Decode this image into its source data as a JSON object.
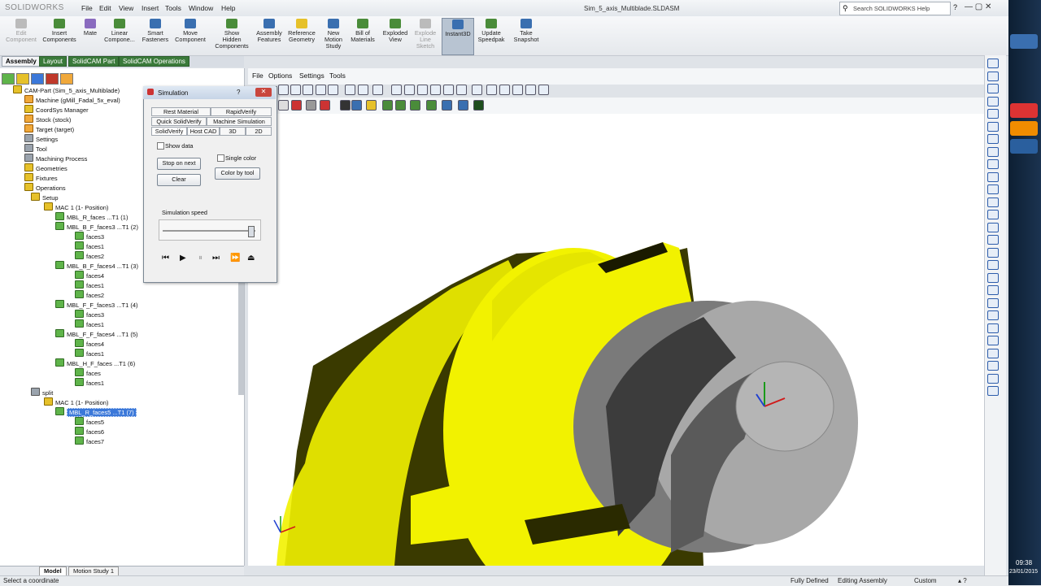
{
  "app": {
    "logo": "SOLIDWORKS",
    "title": "Sim_5_axis_Multiblade.SLDASM",
    "search_placeholder": "Search SOLIDWORKS Help"
  },
  "menu": [
    "File",
    "Edit",
    "View",
    "Insert",
    "Tools",
    "Window",
    "Help"
  ],
  "ribbon": [
    {
      "label": "Edit\nComponent",
      "dim": true
    },
    {
      "label": "Insert\nComponents"
    },
    {
      "label": "Mate"
    },
    {
      "label": "Linear\nCompone..."
    },
    {
      "label": "Smart\nFasteners"
    },
    {
      "label": "Move\nComponent"
    },
    {
      "label": "Show\nHidden\nComponents"
    },
    {
      "label": "Assembly\nFeatures"
    },
    {
      "label": "Reference\nGeometry"
    },
    {
      "label": "New\nMotion\nStudy"
    },
    {
      "label": "Bill of\nMaterials"
    },
    {
      "label": "Exploded\nView"
    },
    {
      "label": "Explode\nLine\nSketch",
      "dim": true
    },
    {
      "label": "Instant3D",
      "active": true
    },
    {
      "label": "Update\nSpeedpak"
    },
    {
      "label": "Take\nSnapshot"
    }
  ],
  "cm_tabs": [
    "Assembly",
    "Layout",
    "SolidCAM Part",
    "SolidCAM Operations"
  ],
  "tree": [
    {
      "label": "CAM-Part (Sim_5_axis_Multiblade)",
      "depth": 0,
      "icon": "y"
    },
    {
      "label": "Machine (gMill_Fadal_5x_eval)",
      "depth": 1,
      "icon": "or"
    },
    {
      "label": "CoordSys Manager",
      "depth": 1,
      "icon": "y"
    },
    {
      "label": "Stock (stock)",
      "depth": 1,
      "icon": "or"
    },
    {
      "label": "Target (target)",
      "depth": 1,
      "icon": "or"
    },
    {
      "label": "Settings",
      "depth": 1,
      "icon": "gr"
    },
    {
      "label": "Tool",
      "depth": 1,
      "icon": "gr"
    },
    {
      "label": "Machining Process",
      "depth": 1,
      "icon": "gr"
    },
    {
      "label": "Geometries",
      "depth": 1,
      "icon": "y"
    },
    {
      "label": "Fixtures",
      "depth": 1,
      "icon": "y"
    },
    {
      "label": "Operations",
      "depth": 1,
      "icon": "y"
    },
    {
      "label": "Setup",
      "depth": 2,
      "icon": "y"
    },
    {
      "label": "MAC 1 (1- Position)",
      "depth": 3,
      "icon": "y"
    },
    {
      "label": "MBL_R_faces ...T1 (1)",
      "depth": 4,
      "icon": "g"
    },
    {
      "label": "MBL_B_F_faces3 ...T1 (2)",
      "depth": 4,
      "icon": "g"
    },
    {
      "label": "faces3",
      "depth": 5,
      "icon": "g"
    },
    {
      "label": "faces1",
      "depth": 5,
      "icon": "g"
    },
    {
      "label": "faces2",
      "depth": 5,
      "icon": "g"
    },
    {
      "label": "MBL_B_F_faces4 ...T1 (3)",
      "depth": 4,
      "icon": "g"
    },
    {
      "label": "faces4",
      "depth": 5,
      "icon": "g"
    },
    {
      "label": "faces1",
      "depth": 5,
      "icon": "g"
    },
    {
      "label": "faces2",
      "depth": 5,
      "icon": "g"
    },
    {
      "label": "MBL_F_F_faces3 ...T1 (4)",
      "depth": 4,
      "icon": "g"
    },
    {
      "label": "faces3",
      "depth": 5,
      "icon": "g"
    },
    {
      "label": "faces1",
      "depth": 5,
      "icon": "g"
    },
    {
      "label": "MBL_F_F_faces4 ...T1 (5)",
      "depth": 4,
      "icon": "g"
    },
    {
      "label": "faces4",
      "depth": 5,
      "icon": "g"
    },
    {
      "label": "faces1",
      "depth": 5,
      "icon": "g"
    },
    {
      "label": "MBL_H_F_faces ...T1 (6)",
      "depth": 4,
      "icon": "g"
    },
    {
      "label": "faces",
      "depth": 5,
      "icon": "g"
    },
    {
      "label": "faces1",
      "depth": 5,
      "icon": "g"
    },
    {
      "label": "split",
      "depth": 2,
      "icon": "gr"
    },
    {
      "label": "MAC 1 (1- Position)",
      "depth": 3,
      "icon": "y"
    },
    {
      "label": "MBL_R_faces5 ...T1 (7)",
      "depth": 4,
      "icon": "g",
      "selected": true
    },
    {
      "label": "faces5",
      "depth": 5,
      "icon": "g"
    },
    {
      "label": "faces6",
      "depth": 5,
      "icon": "g"
    },
    {
      "label": "faces7",
      "depth": 5,
      "icon": "g"
    }
  ],
  "bottom_tabs": [
    "Model",
    "Motion Study 1"
  ],
  "status": {
    "left": "Select a coordinate",
    "defined": "Fully Defined",
    "mode": "Editing Assembly",
    "units": "Custom"
  },
  "gfx_menu": [
    "File",
    "Options",
    "Settings",
    "Tools"
  ],
  "simulation": {
    "title": "Simulation",
    "tabs_row1": [
      "Rest Material",
      "RapidVerify"
    ],
    "tabs_row2": [
      "Quick SolidVerify",
      "Machine Simulation"
    ],
    "tabs_row3": [
      "SolidVerify",
      "Host CAD",
      "3D",
      "2D"
    ],
    "show_data": "Show data",
    "single_color": "Single color",
    "stop_on_next": "Stop on next",
    "clear": "Clear",
    "color_by_tool": "Color by tool",
    "speed_label": "Simulation speed",
    "speed_level": 0.95
  },
  "clock": {
    "time": "09:38",
    "date": "23/01/2015"
  },
  "colors": {
    "part_yellow": "#f2f200",
    "part_shadow": "#2f2f00",
    "blade_gray": "#8c8c8c",
    "select_blue": "#3b78d9"
  }
}
